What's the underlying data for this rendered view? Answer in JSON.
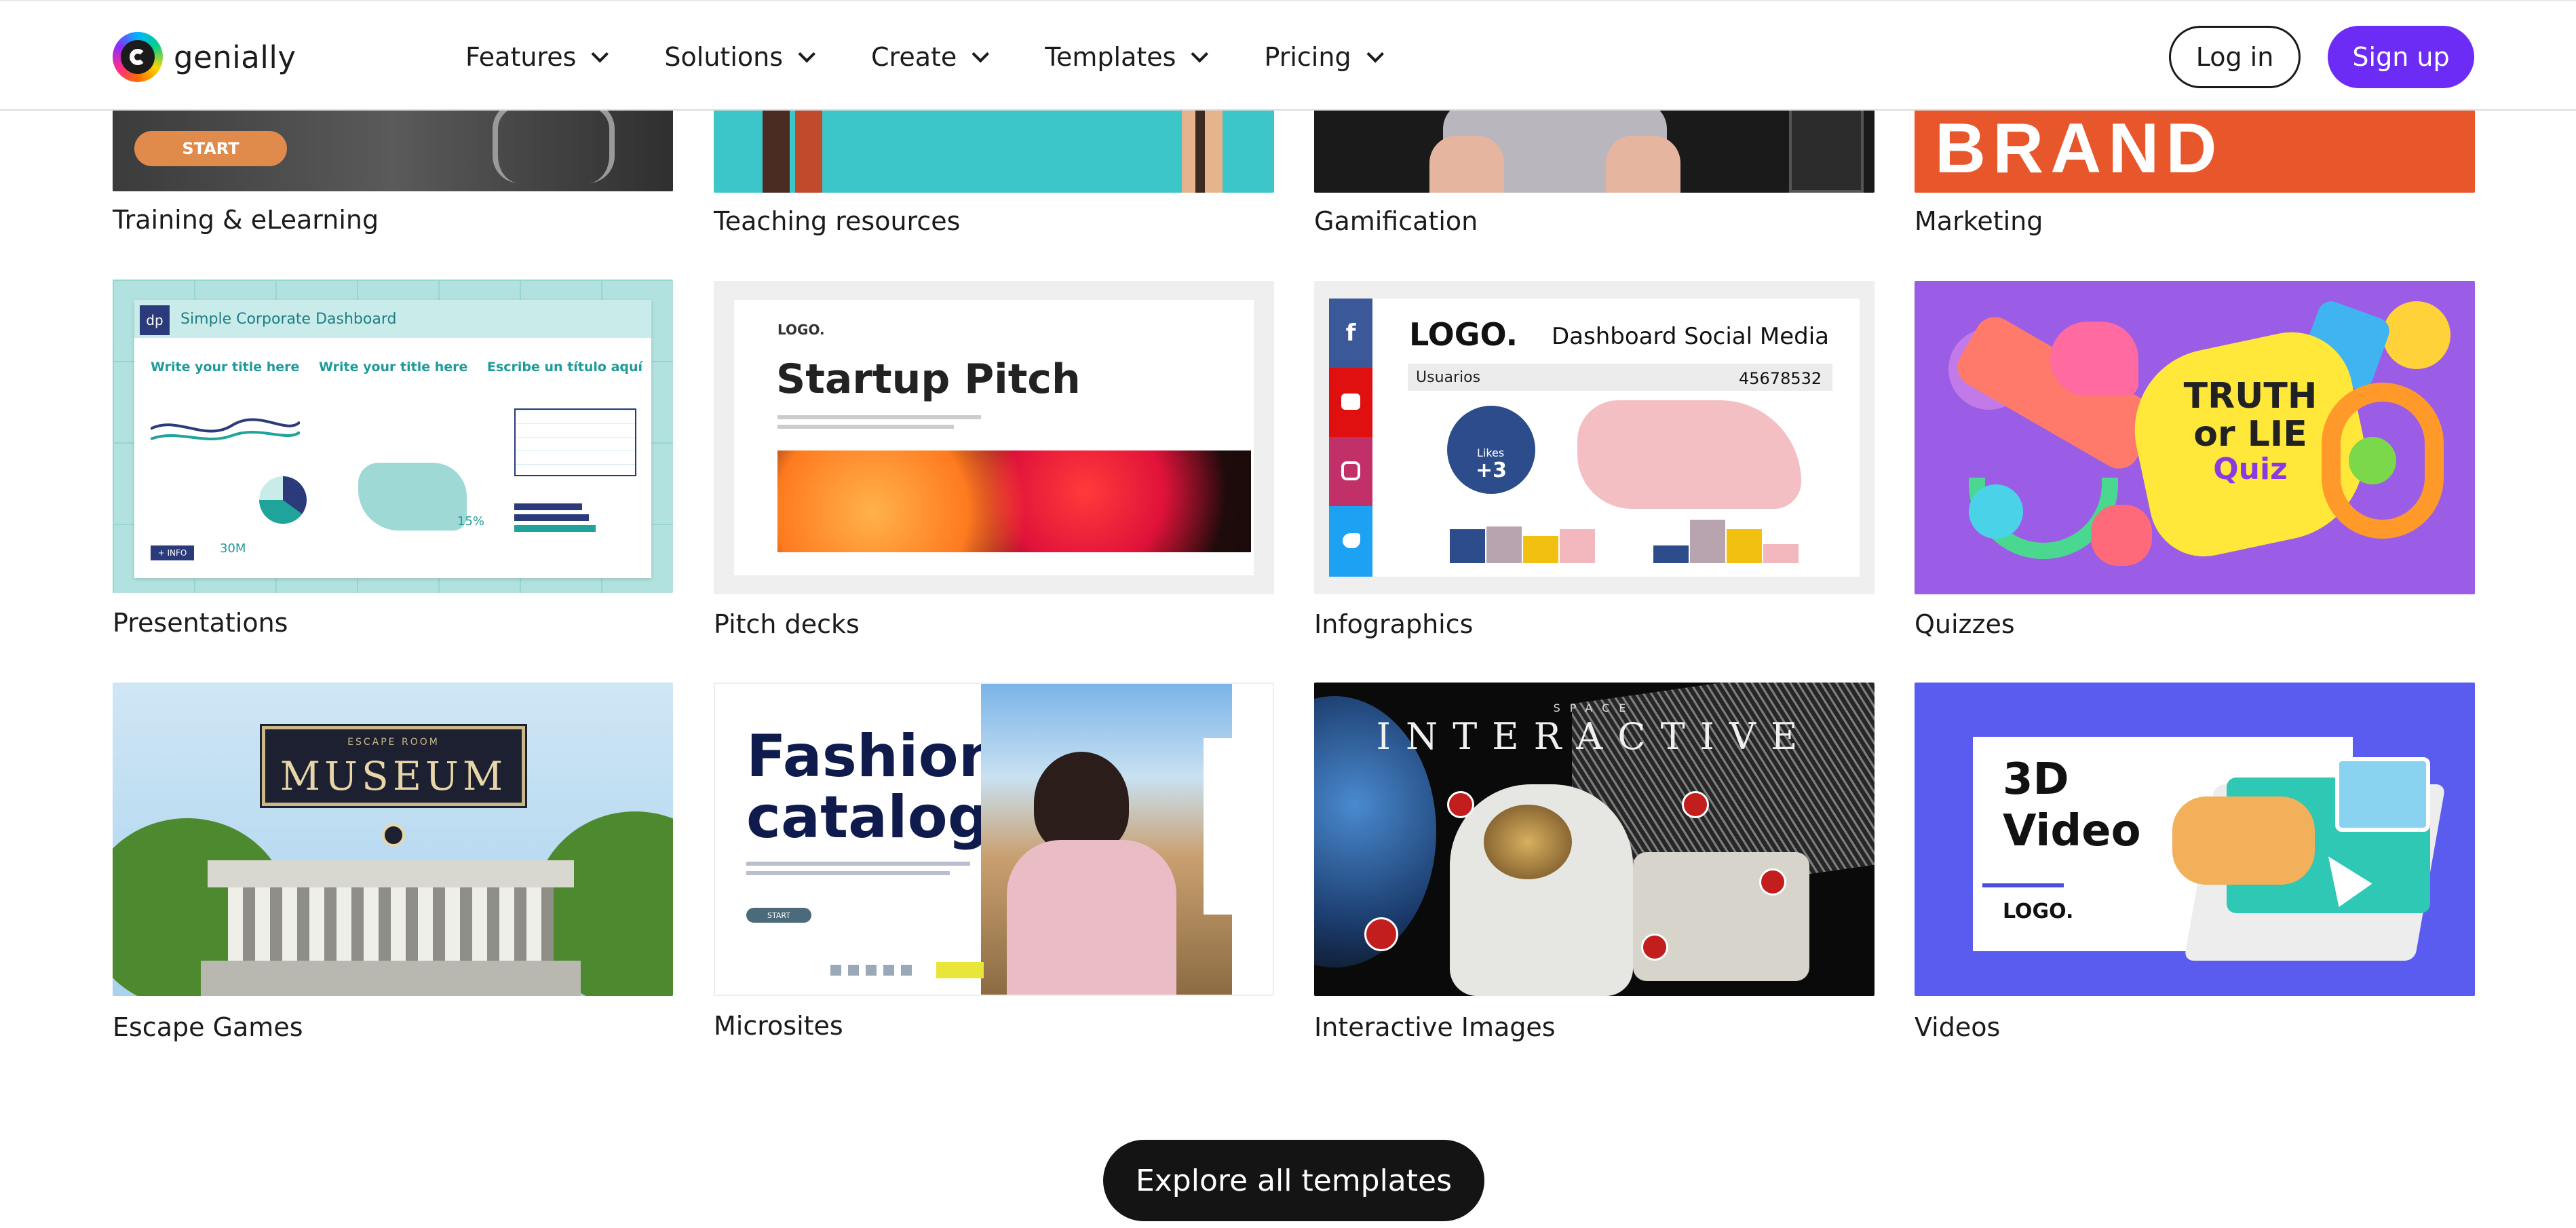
{
  "header": {
    "logo_text": "genially",
    "nav": [
      {
        "label": "Features"
      },
      {
        "label": "Solutions"
      },
      {
        "label": "Create"
      },
      {
        "label": "Templates"
      },
      {
        "label": "Pricing"
      }
    ],
    "login_label": "Log in",
    "signup_label": "Sign up"
  },
  "colors": {
    "accent": "#6d2cf5",
    "dark_button": "#141414"
  },
  "rows": [
    [
      {
        "label": "Training & eLearning",
        "thumb_text": [
          "START"
        ]
      },
      {
        "label": "Teaching resources",
        "thumb_text": []
      },
      {
        "label": "Gamification",
        "thumb_text": []
      },
      {
        "label": "Marketing",
        "thumb_text": [
          "BRAND"
        ]
      }
    ],
    [
      {
        "label": "Presentations",
        "thumb_text": [
          "Simple Corporate Dashboard",
          "Write your title here",
          "Write your title here",
          "Escribe un título aquí",
          "+ INFO",
          "30M",
          "15%"
        ]
      },
      {
        "label": "Pitch decks",
        "thumb_text": [
          "LOGO.",
          "Startup Pitch"
        ]
      },
      {
        "label": "Infographics",
        "thumb_text": [
          "LOGO.",
          "Dashboard Social Media",
          "Usuarios",
          "45678532",
          "Likes",
          "+3"
        ]
      },
      {
        "label": "Quizzes",
        "thumb_text": [
          "TRUTH",
          "or LIE",
          "Quiz"
        ]
      }
    ],
    [
      {
        "label": "Escape Games",
        "thumb_text": [
          "ESCAPE ROOM",
          "MUSEUM"
        ]
      },
      {
        "label": "Microsites",
        "thumb_text": [
          "Fashion",
          "catalog",
          "START"
        ]
      },
      {
        "label": "Interactive Images",
        "thumb_text": [
          "SPACE",
          "INTERACTIVE"
        ]
      },
      {
        "label": "Videos",
        "thumb_text": [
          "3D",
          "Video",
          "LOGO."
        ]
      }
    ]
  ],
  "explore_label": "Explore all templates"
}
